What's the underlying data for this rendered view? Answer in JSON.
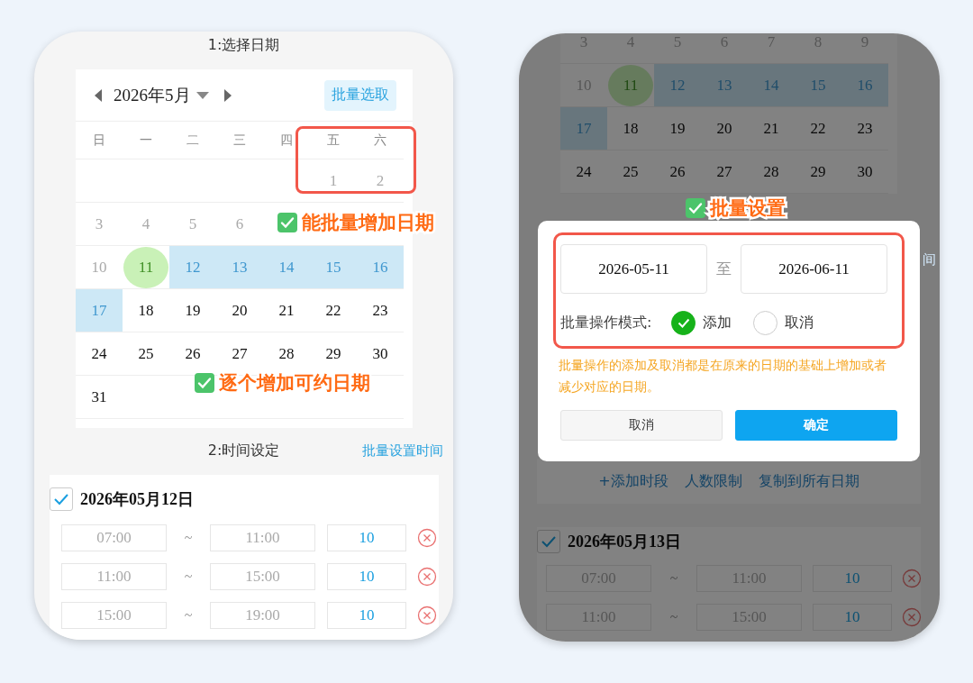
{
  "left_screen": {
    "title": "1:选择日期",
    "calendar": {
      "month": "2026年5月",
      "batch_button": "批量选取",
      "weekdays": [
        "日",
        "一",
        "二",
        "三",
        "四",
        "五",
        "六"
      ],
      "weeks": [
        [
          {
            "kind": "blank"
          },
          {
            "kind": "blank"
          },
          {
            "kind": "blank"
          },
          {
            "kind": "blank"
          },
          {
            "kind": "blank"
          },
          {
            "kind": "muted",
            "day": "1"
          },
          {
            "kind": "muted",
            "day": "2"
          }
        ],
        [
          {
            "kind": "muted",
            "day": "3"
          },
          {
            "kind": "muted",
            "day": "4"
          },
          {
            "kind": "muted",
            "day": "5"
          },
          {
            "kind": "muted",
            "day": "6"
          },
          {
            "kind": "blank"
          },
          {
            "kind": "blank"
          },
          {
            "kind": "blank"
          }
        ],
        [
          {
            "kind": "muted",
            "day": "10"
          },
          {
            "kind": "today",
            "day": "11"
          },
          {
            "kind": "range",
            "day": "12"
          },
          {
            "kind": "range",
            "day": "13"
          },
          {
            "kind": "range",
            "day": "14"
          },
          {
            "kind": "range",
            "day": "15"
          },
          {
            "kind": "range",
            "day": "16"
          }
        ],
        [
          {
            "kind": "range",
            "day": "17"
          },
          {
            "kind": "normal",
            "day": "18"
          },
          {
            "kind": "normal",
            "day": "19"
          },
          {
            "kind": "normal",
            "day": "20"
          },
          {
            "kind": "normal",
            "day": "21"
          },
          {
            "kind": "normal",
            "day": "22"
          },
          {
            "kind": "normal",
            "day": "23"
          }
        ],
        [
          {
            "kind": "normal",
            "day": "24"
          },
          {
            "kind": "normal",
            "day": "25"
          },
          {
            "kind": "normal",
            "day": "26"
          },
          {
            "kind": "normal",
            "day": "27"
          },
          {
            "kind": "normal",
            "day": "28"
          },
          {
            "kind": "normal",
            "day": "29"
          },
          {
            "kind": "normal",
            "day": "30"
          }
        ],
        [
          {
            "kind": "normal",
            "day": "31"
          },
          {
            "kind": "blank"
          },
          {
            "kind": "blank"
          },
          {
            "kind": "blank"
          },
          {
            "kind": "blank"
          },
          {
            "kind": "blank"
          },
          {
            "kind": "blank"
          }
        ]
      ]
    },
    "annotations": [
      "能批量增加日期",
      "逐个增加可约日期"
    ],
    "section": {
      "title": "2:时间设定",
      "link": "批量设置时间"
    },
    "schedule": {
      "checked": true,
      "date": "2026年05月12日",
      "slots": [
        {
          "start": "07:00",
          "separator": "~",
          "end": "11:00",
          "count": "10"
        },
        {
          "start": "11:00",
          "separator": "~",
          "end": "15:00",
          "count": "10"
        },
        {
          "start": "15:00",
          "separator": "~",
          "end": "19:00",
          "count": "10"
        }
      ]
    }
  },
  "right_screen": {
    "calendar": {
      "weeks": [
        [
          {
            "kind": "muted",
            "day": "3"
          },
          {
            "kind": "muted",
            "day": "4"
          },
          {
            "kind": "muted",
            "day": "5"
          },
          {
            "kind": "muted",
            "day": "6"
          },
          {
            "kind": "muted",
            "day": "7"
          },
          {
            "kind": "muted",
            "day": "8"
          },
          {
            "kind": "muted",
            "day": "9"
          }
        ],
        [
          {
            "kind": "muted",
            "day": "10"
          },
          {
            "kind": "today",
            "day": "11"
          },
          {
            "kind": "range",
            "day": "12"
          },
          {
            "kind": "range",
            "day": "13"
          },
          {
            "kind": "range",
            "day": "14"
          },
          {
            "kind": "range",
            "day": "15"
          },
          {
            "kind": "range",
            "day": "16"
          }
        ],
        [
          {
            "kind": "range",
            "day": "17"
          },
          {
            "kind": "normal",
            "day": "18"
          },
          {
            "kind": "normal",
            "day": "19"
          },
          {
            "kind": "normal",
            "day": "20"
          },
          {
            "kind": "normal",
            "day": "21"
          },
          {
            "kind": "normal",
            "day": "22"
          },
          {
            "kind": "normal",
            "day": "23"
          }
        ],
        [
          {
            "kind": "normal",
            "day": "24"
          },
          {
            "kind": "normal",
            "day": "25"
          },
          {
            "kind": "normal",
            "day": "26"
          },
          {
            "kind": "normal",
            "day": "27"
          },
          {
            "kind": "normal",
            "day": "28"
          },
          {
            "kind": "normal",
            "day": "29"
          },
          {
            "kind": "normal",
            "day": "30"
          }
        ]
      ]
    },
    "cut_link": "间",
    "actions": [
      "+添加时段",
      "人数限制",
      "复制到所有日期"
    ],
    "schedule": {
      "checked": true,
      "date": "2026年05月13日",
      "slots": [
        {
          "start": "07:00",
          "separator": "~",
          "end": "11:00",
          "count": "10"
        },
        {
          "start": "11:00",
          "separator": "~",
          "end": "15:00",
          "count": "10"
        }
      ]
    },
    "annotation": "批量设置",
    "dialog": {
      "start_date": "2026-05-11",
      "to_label": "至",
      "end_date": "2026-06-11",
      "mode_label": "批量操作模式:",
      "modes": [
        {
          "label": "添加",
          "selected": true
        },
        {
          "label": "取消",
          "selected": false
        }
      ],
      "note": "批量操作的添加及取消都是在原来的日期的基础上增加或者减少对应的日期。",
      "buttons": [
        {
          "label": "取消",
          "kind": "secondary"
        },
        {
          "label": "确定",
          "kind": "primary"
        }
      ]
    }
  }
}
